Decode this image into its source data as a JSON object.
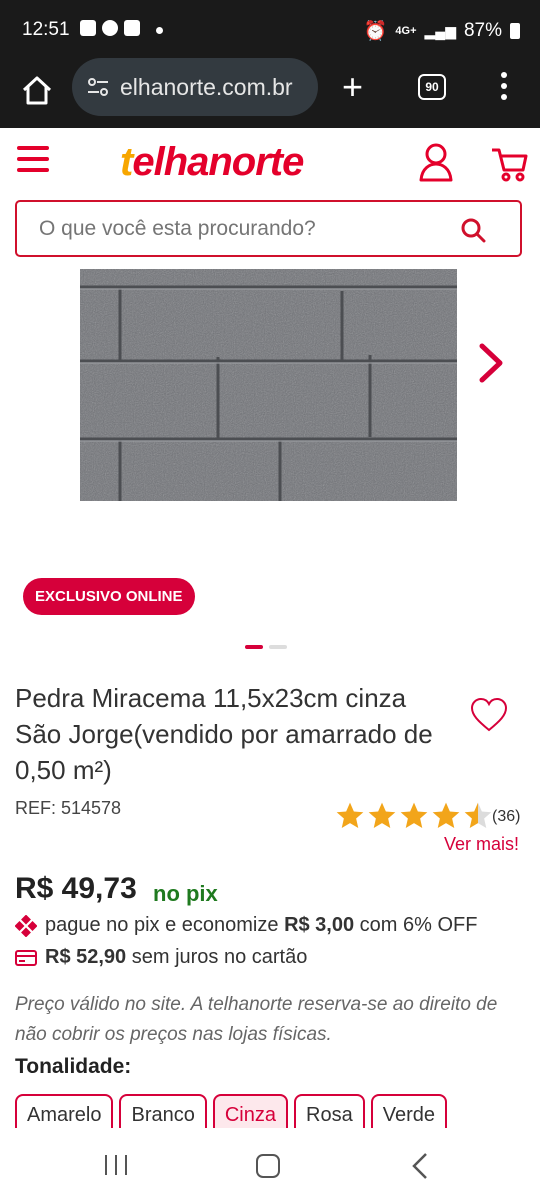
{
  "status_bar": {
    "time": "12:51",
    "network": "4G+",
    "battery": "87%"
  },
  "browser": {
    "url": "elhanorte.com.br",
    "tab_count": "90"
  },
  "header": {
    "logo_prefix": "t",
    "logo_rest": "elhanorte"
  },
  "search": {
    "placeholder": "O que você esta procurando?"
  },
  "product": {
    "badge": "EXCLUSIVO ONLINE",
    "title": "Pedra Miracema 11,5x23cm cinza São Jorge(vendido por amarrado de 0,50 m²)",
    "ref": "REF: 514578",
    "rating": 4.5,
    "reviews": "(36)",
    "see_more": "Ver mais!",
    "price": "R$ 49,73",
    "price_suffix": "no pix",
    "pix_pre": "pague no pix e economize ",
    "pix_saving": "R$ 3,00",
    "pix_post": " com 6% OFF",
    "card_price": "R$ 52,90",
    "card_text": " sem juros no cartão",
    "disclaimer": "Preço válido no site. A telhanorte reserva-se ao direito de não cobrir os preços nas lojas físicas.",
    "tonality_label": "Tonalidade:",
    "tonalities": [
      "Amarelo",
      "Branco",
      "Cinza",
      "Rosa",
      "Verde"
    ],
    "selected_tonality": "Cinza"
  },
  "colors": {
    "brand_red": "#e4002b",
    "brand_yellow": "#f7a600",
    "pix_green": "#1f7a1f"
  },
  "carousel": {
    "current": 1,
    "total": 2
  }
}
